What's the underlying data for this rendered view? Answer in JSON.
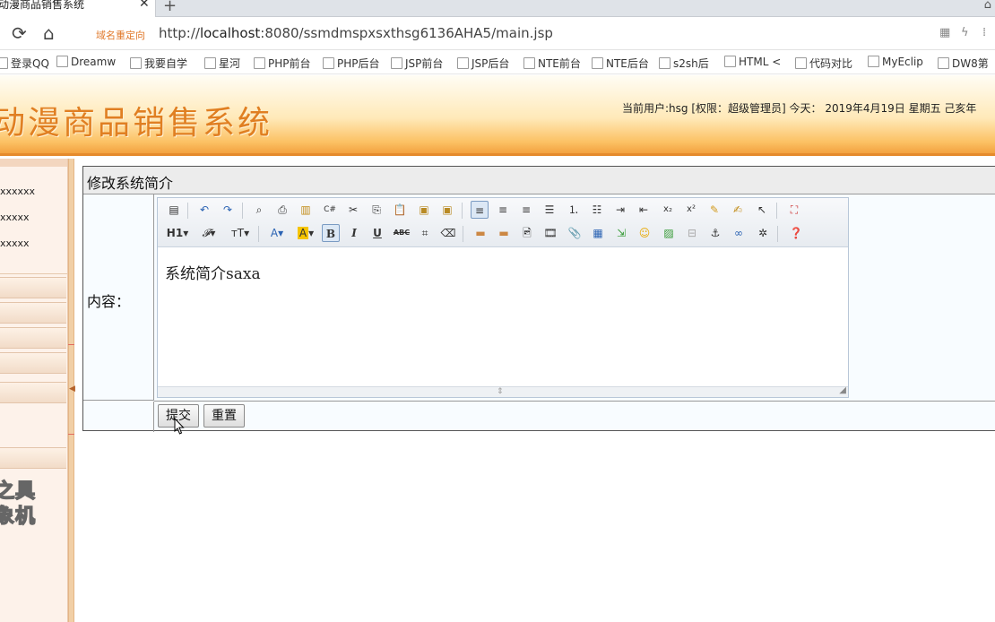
{
  "browser": {
    "tab_title": "动漫商品销售系统",
    "tab_close": "✕",
    "new_tab": "+",
    "redirect_label": "域名重定向",
    "url_prefix": "http://",
    "url_host": "localhost",
    "url_rest": ":8080/ssmdmspxsxthsg6136AHA5/main.jsp"
  },
  "bookmarks": [
    {
      "label": "登录QQ"
    },
    {
      "label": "Dreamw"
    },
    {
      "label": "我要自学"
    },
    {
      "label": "星河"
    },
    {
      "label": "PHP前台"
    },
    {
      "label": "PHP后台"
    },
    {
      "label": "JSP前台"
    },
    {
      "label": "JSP后台"
    },
    {
      "label": "NTE前台"
    },
    {
      "label": "NTE后台"
    },
    {
      "label": "s2sh后"
    },
    {
      "label": "HTML <"
    },
    {
      "label": "代码对比"
    },
    {
      "label": "MyEclip"
    },
    {
      "label": "DW8第"
    }
  ],
  "header": {
    "title": "动漫商品销售系统",
    "user_info": "当前用户:hsg [权限：超级管理员] 今天： 2019年4月19日 星期五 己亥年"
  },
  "sidebar": {
    "items": [
      "xxxxxx",
      "xxxxx",
      "xxxxx"
    ],
    "logo_line1": "之具",
    "logo_line2": "象机"
  },
  "form": {
    "heading": "修改系统简介",
    "content_label": "内容：",
    "editor_text": "系统简介saxa",
    "submit_label": "提交",
    "reset_label": "重置"
  },
  "toolbar": {
    "heading_label": "H1",
    "font_family_label": "𝓕",
    "font_size_label": "тT",
    "font_color_label": "A",
    "bg_color_label": "A",
    "bold_label": "B",
    "italic_label": "I",
    "underline_label": "U",
    "strike_label": "ABC",
    "subscript_label": "x₂",
    "superscript_label": "x²"
  }
}
